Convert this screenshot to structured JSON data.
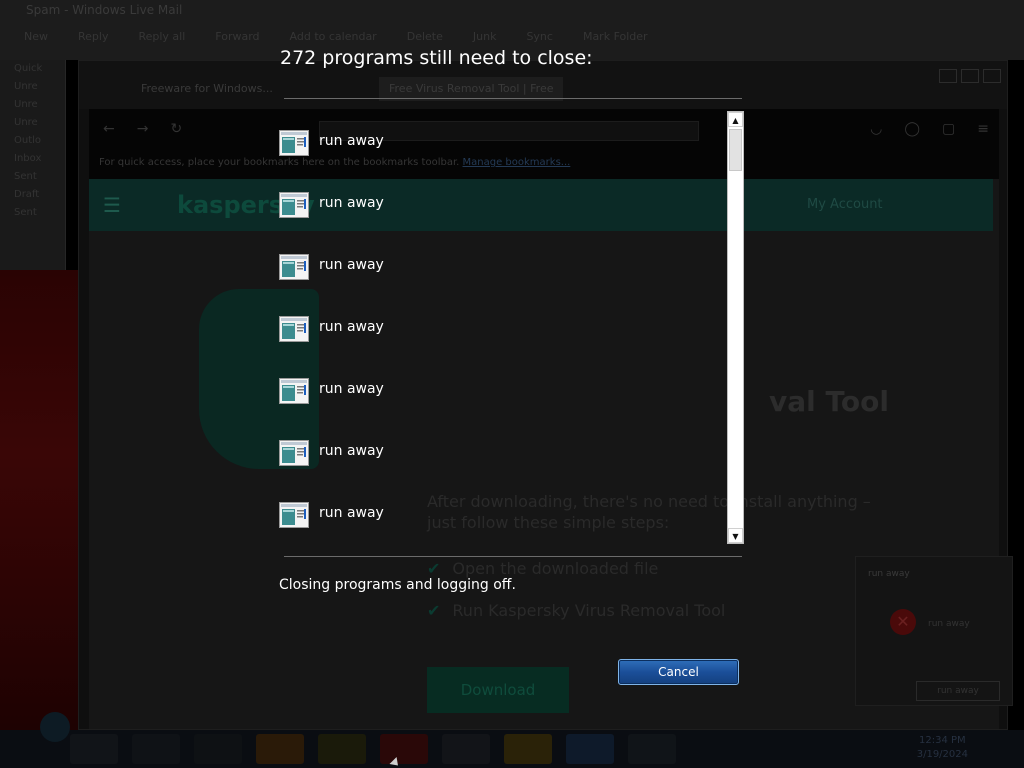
{
  "background": {
    "mail_window": {
      "title": "Spam - Windows Live Mail",
      "ribbon": [
        "New",
        "Reply",
        "Reply all",
        "Forward",
        "Add to calendar",
        "Delete",
        "Junk",
        "Sync",
        "Mark Folder"
      ],
      "sidebar": [
        "Quick",
        "Unre",
        "Unre",
        "Unre",
        "Outlo",
        "Inbox",
        "Sent",
        "Draft",
        "Sent"
      ]
    },
    "browser": {
      "tabs": [
        "Freeware for Windows...",
        "Free Virus Removal Tool | Free"
      ],
      "bookmark_hint": "For quick access, place your bookmarks here on the bookmarks toolbar.",
      "bookmark_link": "Manage bookmarks...",
      "site": {
        "logo": "kaspersky",
        "account": "My Account",
        "heading": "val Tool",
        "body": "After downloading, there's no need to install anything – just follow these simple steps:",
        "steps": [
          "Open the downloaded file",
          "Run Kaspersky Virus Removal Tool"
        ],
        "download_label": "Download"
      }
    },
    "notification": {
      "title": "run away",
      "message": "run away",
      "button": "run away"
    },
    "clock": {
      "time": "12:34 PM",
      "date": "3/19/2024"
    }
  },
  "dialog": {
    "title": "272 programs still need to close:",
    "programs": [
      {
        "label": "run away"
      },
      {
        "label": "run away"
      },
      {
        "label": "run away"
      },
      {
        "label": "run away"
      },
      {
        "label": "run away"
      },
      {
        "label": "run away"
      },
      {
        "label": "run away"
      }
    ],
    "status": "Closing programs and logging off.",
    "cancel_label": "Cancel"
  },
  "colors": {
    "dialog_text": "#ffffff",
    "cancel_button": "#1b4f99",
    "scrollbar": "#ffffff"
  }
}
